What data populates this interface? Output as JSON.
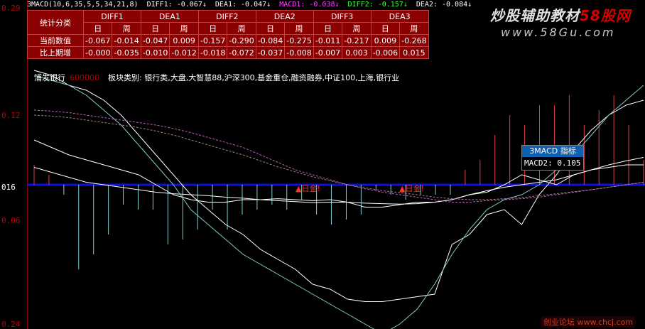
{
  "header": {
    "indicator": "3MACD(10,6,35,5,5,34,21,8)",
    "diff1": "DIFF1: -0.067↓",
    "dea1": "DEA1: -0.047↓",
    "macd1": "MACD1: -0.038↓",
    "diff2": "DIFF2: -0.157↓",
    "dea2": "DEA2: -0.084↓",
    "colors": {
      "white": "#ffffff",
      "magenta": "#ff40ff",
      "green": "#40ff40",
      "blue": "#4040ff"
    }
  },
  "y_axis": {
    "labels": [
      "0.29",
      "0.12",
      "016",
      "0.06",
      "0.24"
    ]
  },
  "table": {
    "corner": "统计分类",
    "groups": [
      "DIFF1",
      "DEA1",
      "DIFF2",
      "DEA2",
      "DIFF3",
      "DEA3"
    ],
    "sub": [
      "日",
      "周"
    ],
    "rows": [
      {
        "label": "当前数值",
        "values": [
          "-0.067",
          "-0.014",
          "-0.047",
          "0.009",
          "-0.157",
          "-0.290",
          "-0.084",
          "-0.275",
          "-0.011",
          "-0.217",
          "0.009",
          "-0.268"
        ]
      },
      {
        "label": "比上期增",
        "values": [
          "-0.000",
          "-0.035",
          "-0.010",
          "-0.012",
          "-0.018",
          "-0.072",
          "-0.037",
          "-0.008",
          "-0.007",
          "0.003",
          "-0.006",
          "0.015"
        ]
      }
    ]
  },
  "info": {
    "name": "浦发银行",
    "code": "600000",
    "sector": "板块类别: 银行类,大盘,大智慧88,沪深300,基金重仓,融资融券,中证100,上海,银行业"
  },
  "markers": [
    "日金!",
    "日金!"
  ],
  "tooltip": {
    "title": "3MACD 指标",
    "value": "MACD2:  0.105"
  },
  "watermark": {
    "title_a": "炒股辅助教材",
    "title_b": "58股网",
    "url": "www.58Gu.com",
    "footer": "创业论坛 www.chcj.com"
  },
  "chart_data": {
    "type": "line",
    "x_count": 36,
    "zero_value": 0,
    "series": [
      {
        "name": "DIFF1",
        "color": "#ffffff",
        "values": [
          0.09,
          0.075,
          0.06,
          0.05,
          0.04,
          0.03,
          0.02,
          0.0,
          -0.02,
          -0.03,
          -0.035,
          -0.035,
          -0.03,
          -0.03,
          -0.028,
          -0.03,
          -0.032,
          -0.03,
          -0.035,
          -0.045,
          -0.045,
          -0.04,
          -0.035,
          -0.035,
          -0.03,
          -0.02,
          -0.015,
          0.0,
          0.02,
          0.01,
          0.0,
          0.02,
          0.03,
          0.035,
          0.04,
          0.04
        ]
      },
      {
        "name": "DEA1",
        "color": "#ffffff",
        "values": [
          0.035,
          0.025,
          0.015,
          0.005,
          0.0,
          -0.005,
          -0.01,
          -0.015,
          -0.018,
          -0.02,
          -0.022,
          -0.025,
          -0.027,
          -0.03,
          -0.032,
          -0.034,
          -0.036,
          -0.035,
          -0.035,
          -0.037,
          -0.038,
          -0.039,
          -0.038,
          -0.035,
          -0.03,
          -0.02,
          -0.012,
          -0.005,
          0.0,
          0.005,
          0.01,
          0.02,
          0.03,
          0.04,
          0.048,
          0.055
        ]
      },
      {
        "name": "DIFF2",
        "color": "#ffffff",
        "values": [
          0.23,
          0.22,
          0.2,
          0.19,
          0.17,
          0.14,
          0.1,
          0.06,
          0.02,
          -0.02,
          -0.05,
          -0.08,
          -0.1,
          -0.13,
          -0.15,
          -0.17,
          -0.2,
          -0.21,
          -0.23,
          -0.235,
          -0.235,
          -0.23,
          -0.225,
          -0.22,
          -0.12,
          -0.1,
          -0.06,
          -0.05,
          -0.08,
          -0.02,
          0.02,
          0.07,
          0.11,
          0.14,
          0.16,
          0.17
        ]
      },
      {
        "name": "DIFF3",
        "color": "#80c8c8",
        "values": [
          0.22,
          0.21,
          0.2,
          0.18,
          0.15,
          0.12,
          0.08,
          0.04,
          0.0,
          -0.05,
          -0.08,
          -0.11,
          -0.14,
          -0.16,
          -0.18,
          -0.2,
          -0.22,
          -0.24,
          -0.26,
          -0.28,
          -0.3,
          -0.28,
          -0.25,
          -0.2,
          -0.14,
          -0.09,
          -0.05,
          -0.03,
          -0.02,
          0.0,
          0.03,
          0.06,
          0.1,
          0.14,
          0.17,
          0.2
        ]
      },
      {
        "name": "DEA2",
        "color": "#c060c0",
        "values": [
          0.15,
          0.148,
          0.145,
          0.14,
          0.135,
          0.13,
          0.125,
          0.12,
          0.113,
          0.105,
          0.095,
          0.085,
          0.075,
          0.06,
          0.045,
          0.03,
          0.02,
          0.01,
          0.0,
          -0.008,
          -0.015,
          -0.02,
          -0.025,
          -0.03,
          -0.035,
          -0.035,
          -0.032,
          -0.03,
          -0.028,
          -0.025,
          -0.02,
          -0.015,
          -0.01,
          -0.005,
          0.0,
          0.005
        ]
      },
      {
        "name": "DEA3",
        "color": "#a08080",
        "values": [
          0.14,
          0.138,
          0.135,
          0.13,
          0.125,
          0.12,
          0.115,
          0.108,
          0.1,
          0.09,
          0.08,
          0.07,
          0.06,
          0.048,
          0.036,
          0.026,
          0.016,
          0.008,
          0.0,
          -0.006,
          -0.012,
          -0.016,
          -0.02,
          -0.025,
          -0.028,
          -0.03,
          -0.03,
          -0.028,
          -0.026,
          -0.022,
          -0.018,
          -0.014,
          -0.01,
          -0.005,
          0.0,
          0.005
        ]
      }
    ],
    "macd_bars": [
      0.04,
      0.02,
      -0.02,
      -0.17,
      -0.14,
      -0.1,
      -0.04,
      -0.05,
      -0.05,
      -0.12,
      -0.11,
      -0.09,
      -0.05,
      -0.09,
      -0.06,
      -0.05,
      -0.04,
      -0.05,
      -0.03,
      -0.06,
      -0.08,
      -0.07,
      -0.06,
      -0.01,
      -0.02,
      -0.03,
      -0.02,
      -0.02,
      -0.02,
      0.03,
      0.05,
      0.1,
      0.14,
      0.12,
      0.16,
      0.16,
      0.18,
      0.12,
      0.15,
      0.18,
      0.12,
      0.05
    ]
  }
}
